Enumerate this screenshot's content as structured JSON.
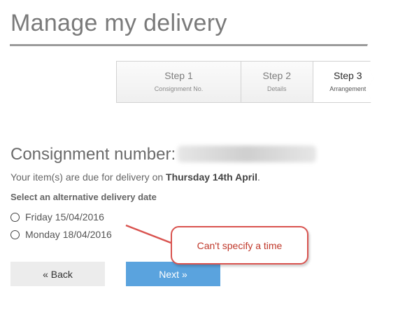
{
  "header": {
    "title": "Manage my delivery"
  },
  "steps": [
    {
      "label": "Step 1",
      "sub": "Consignment No.",
      "active": false
    },
    {
      "label": "Step 2",
      "sub": "Details",
      "active": false
    },
    {
      "label": "Step 3",
      "sub": "Arrangement",
      "active": true
    }
  ],
  "consignment": {
    "label": "Consignment number:"
  },
  "due": {
    "prefix": "Your item(s) are due for delivery on ",
    "date": "Thursday 14th April",
    "suffix": "."
  },
  "alt": {
    "label": "Select an alternative delivery date",
    "options": [
      "Friday 15/04/2016",
      "Monday 18/04/2016"
    ]
  },
  "buttons": {
    "back": "« Back",
    "next": "Next »"
  },
  "callout": {
    "text": "Can't specify a time"
  },
  "colors": {
    "accent": "#5aa3de",
    "callout_border": "#d9534f"
  }
}
